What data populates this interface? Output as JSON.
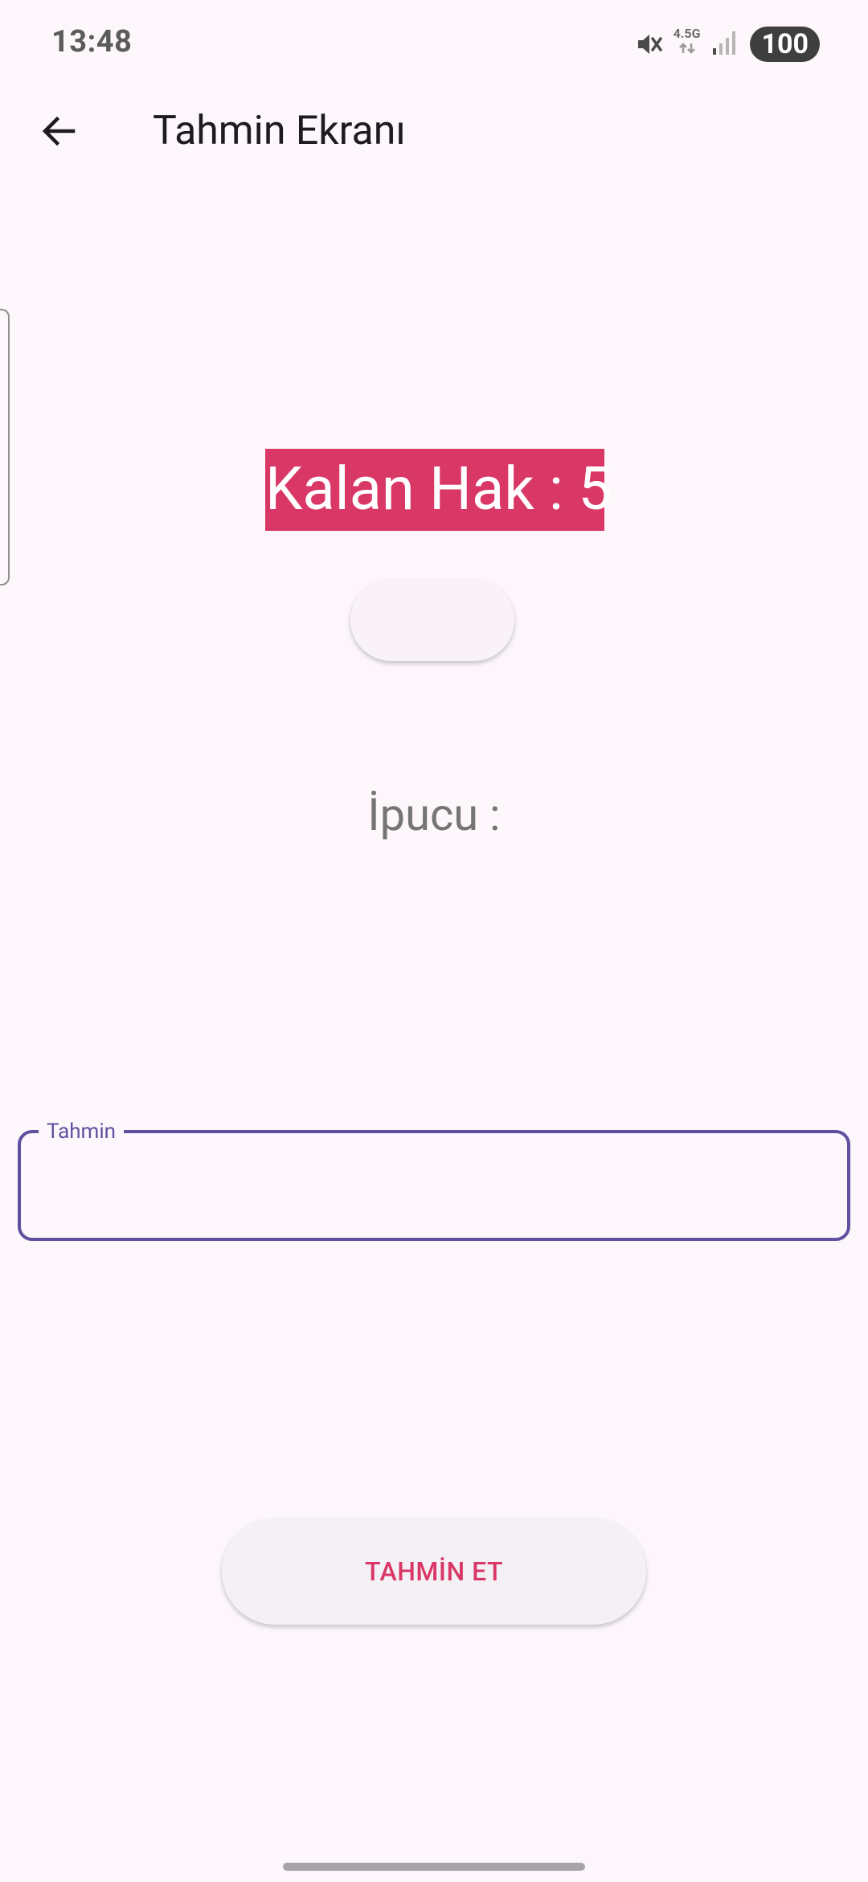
{
  "status_bar": {
    "time": "13:48",
    "network": "4.5G",
    "battery": "100",
    "icons": [
      "mute-icon",
      "network-arrows-icon",
      "signal-icon"
    ]
  },
  "app_bar": {
    "title": "Tahmin Ekranı",
    "back_icon": "arrow-back-icon"
  },
  "main": {
    "remaining_label": "Kalan Hak : 5",
    "blank_button_label": "",
    "hint_label": "İpucu :",
    "guess_field": {
      "label": "Tahmin",
      "value": "",
      "placeholder": ""
    },
    "guess_button_label": "TAHMİN ET"
  },
  "colors": {
    "accent": "#d93766",
    "field_border": "#6150a0",
    "background": "#fdf7fc"
  }
}
